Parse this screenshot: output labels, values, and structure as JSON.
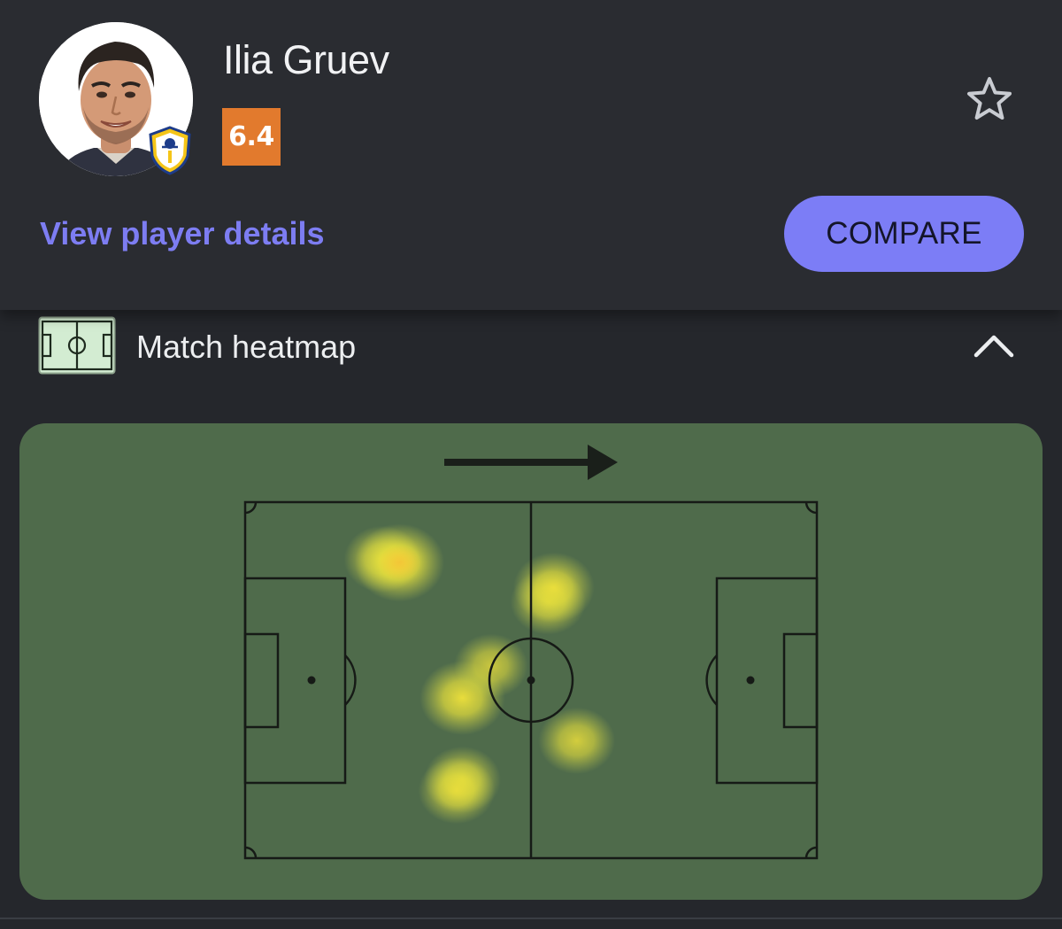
{
  "player": {
    "name": "Ilia Gruev",
    "rating": "6.4",
    "rating_color": "#e27a2d",
    "club_badge_icon": "leeds-united-crest"
  },
  "actions": {
    "details_link": "View player details",
    "compare_label": "COMPARE",
    "favorite_icon": "star-outline-icon",
    "accent_color": "#7c7df6"
  },
  "heatmap": {
    "section_title": "Match heatmap",
    "section_icon": "football-pitch-icon",
    "collapse_icon": "chevron-up-icon",
    "attack_direction": "left-to-right",
    "pitch_color": "#4f6b4b",
    "spots": [
      {
        "x": 24,
        "y": 84,
        "intensity": 0.55
      },
      {
        "x": 38,
        "y": 22,
        "intensity": 0.55
      },
      {
        "x": 27,
        "y": 83,
        "intensity": 1.0
      },
      {
        "x": 38,
        "y": 45,
        "intensity": 0.85
      },
      {
        "x": 53,
        "y": 72,
        "intensity": 0.5
      },
      {
        "x": 58,
        "y": 33,
        "intensity": 0.55
      },
      {
        "x": 43,
        "y": 54,
        "intensity": 0.45
      },
      {
        "x": 54,
        "y": 76,
        "intensity": 0.7
      },
      {
        "x": 37,
        "y": 19,
        "intensity": 0.55
      }
    ]
  }
}
